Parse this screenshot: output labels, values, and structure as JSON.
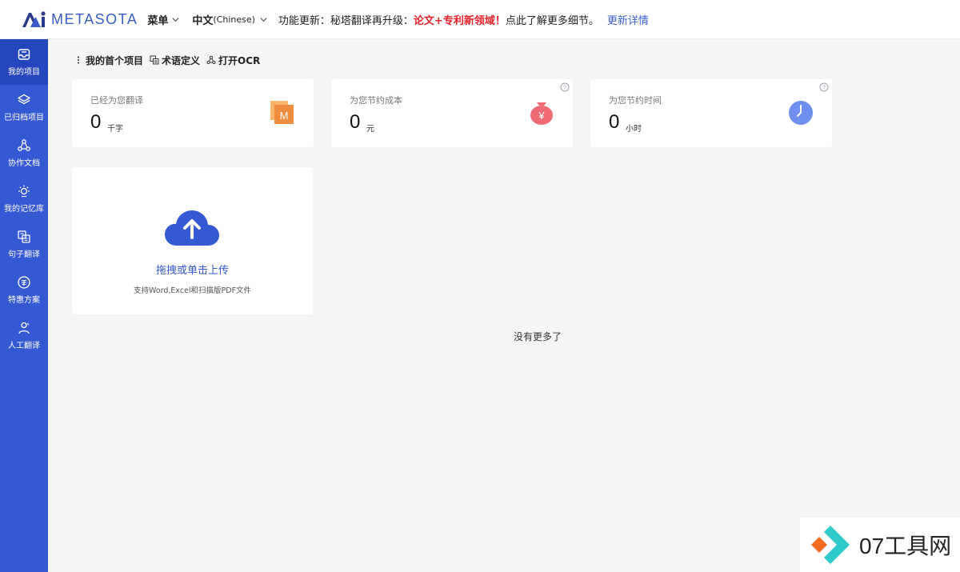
{
  "header": {
    "brand": "METASOTA",
    "menu_label": "菜单",
    "lang_label": "中文",
    "lang_sub": "(Chinese)",
    "news_prefix": "功能更新：秘塔翻译再升级：",
    "news_highlight": "论文+专利新领域！",
    "news_suffix": "点此了解更多细节。",
    "news_link": "更新详情"
  },
  "sidebar": {
    "items": [
      {
        "label": "我的项目",
        "icon": "inbox-icon",
        "active": true
      },
      {
        "label": "已归档项目",
        "icon": "layers-icon"
      },
      {
        "label": "协作文档",
        "icon": "collab-icon"
      },
      {
        "label": "我的记忆库",
        "icon": "bulb-icon"
      },
      {
        "label": "句子翻译",
        "icon": "translate-icon"
      },
      {
        "label": "特惠方案",
        "icon": "discount-icon"
      },
      {
        "label": "人工翻译",
        "icon": "person-icon"
      }
    ]
  },
  "toolbar": {
    "project": "我的首个项目",
    "glossary": "术语定义",
    "ocr": "打开OCR"
  },
  "stats": [
    {
      "label": "已经为您翻译",
      "value": "0",
      "unit": "千字",
      "icon": "document-m-icon"
    },
    {
      "label": "为您节约成本",
      "value": "0",
      "unit": "元",
      "icon": "money-bag-icon"
    },
    {
      "label": "为您节约时间",
      "value": "0",
      "unit": "小时",
      "icon": "clock-icon"
    }
  ],
  "upload": {
    "title": "拖拽或单击上传",
    "desc": "支持Word,Excel和扫描版PDF文件"
  },
  "list_end": "没有更多了",
  "watermark": "07工具网",
  "colors": {
    "accent": "#3558d3",
    "highlight": "#e8202a",
    "sidebar_active": "#2646bd"
  }
}
